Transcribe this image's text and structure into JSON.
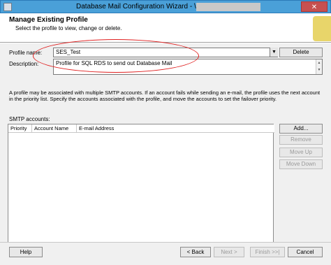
{
  "window": {
    "title": "Database Mail Configuration Wizard - \\",
    "close_glyph": "✕"
  },
  "header": {
    "title": "Manage Existing Profile",
    "subtitle": "Select the profile to view, change or delete."
  },
  "form": {
    "profile_name_label": "Profile name:",
    "profile_name_value": "SES_Test",
    "delete_label": "Delete",
    "description_label": "Description:",
    "description_value": "Profile for SQL RDS to send out Database Mail"
  },
  "info_text": "A profile may be associated with multiple SMTP accounts. If an account fails while sending an e-mail, the profile uses the next account in the priority list. Specify the accounts associated with the profile, and move the accounts to set the failover priority.",
  "smtp": {
    "label": "SMTP accounts:",
    "columns": [
      "Priority",
      "Account Name",
      "E-mail Address"
    ],
    "rows": [],
    "buttons": {
      "add": "Add...",
      "remove": "Remove",
      "move_up": "Move Up",
      "move_down": "Move Down"
    }
  },
  "footer": {
    "help": "Help",
    "back": "< Back",
    "next": "Next >",
    "finish": "Finish >>|",
    "cancel": "Cancel"
  },
  "colors": {
    "titlebar": "#4aa0d8",
    "annotation": "#e02020",
    "panel": "#f0f0f0"
  }
}
